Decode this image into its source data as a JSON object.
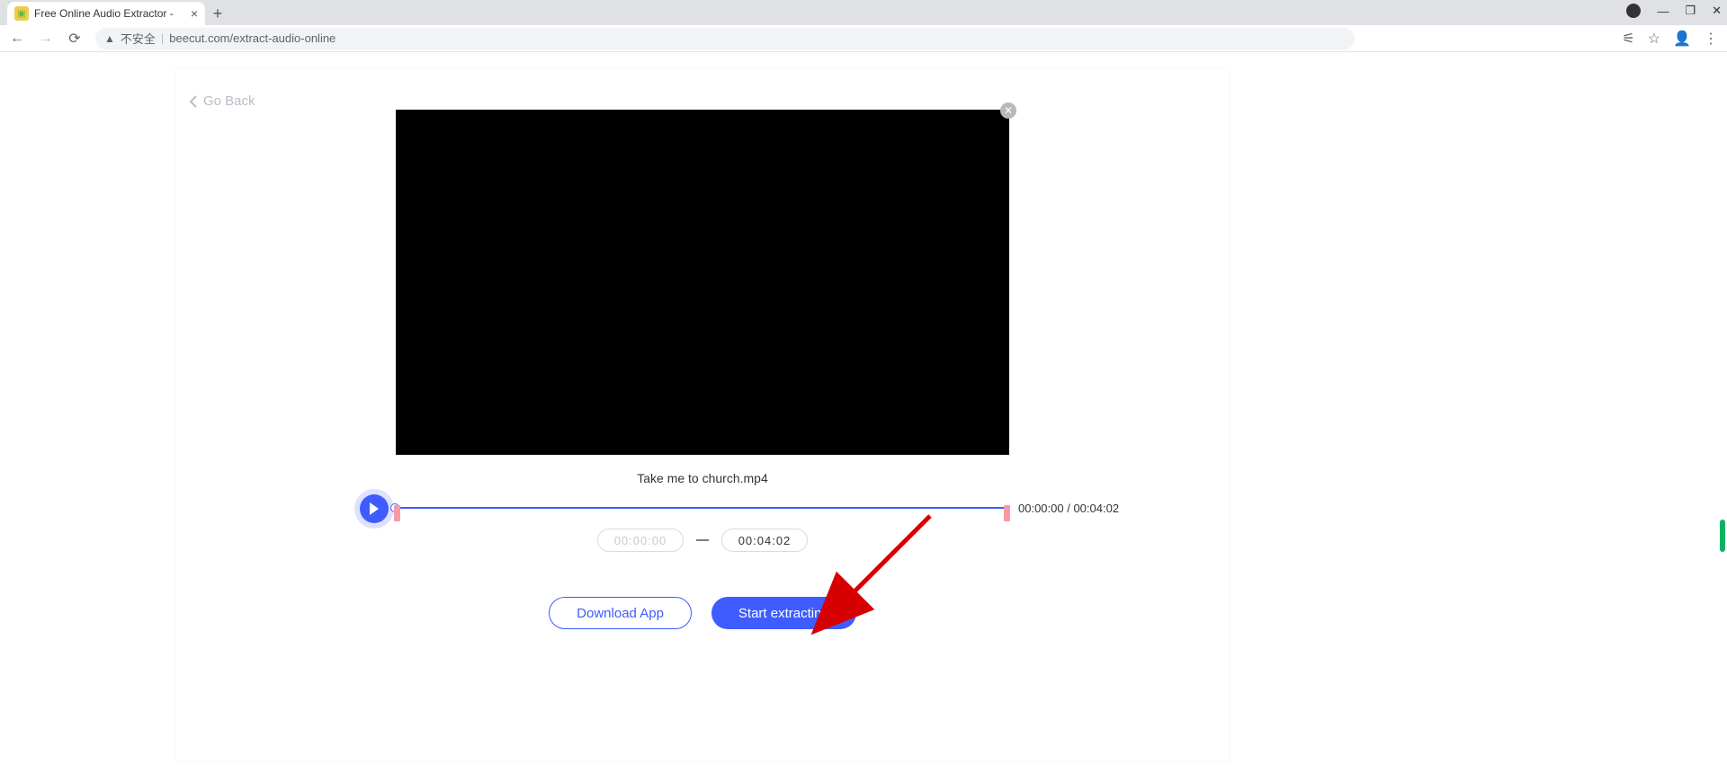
{
  "browser": {
    "tab_title": "Free Online Audio Extractor - ",
    "security_label": "不安全",
    "url": "beecut.com/extract-audio-online"
  },
  "header": {
    "go_back_label": "Go Back"
  },
  "video": {
    "filename": "Take me to church.mp4"
  },
  "timeline": {
    "current_time": "00:00:00",
    "total_time": "00:04:02",
    "separator": " / ",
    "start_input": "00:00:00",
    "end_input": "00:04:02"
  },
  "buttons": {
    "download_app": "Download App",
    "start_extracting": "Start extracting"
  }
}
